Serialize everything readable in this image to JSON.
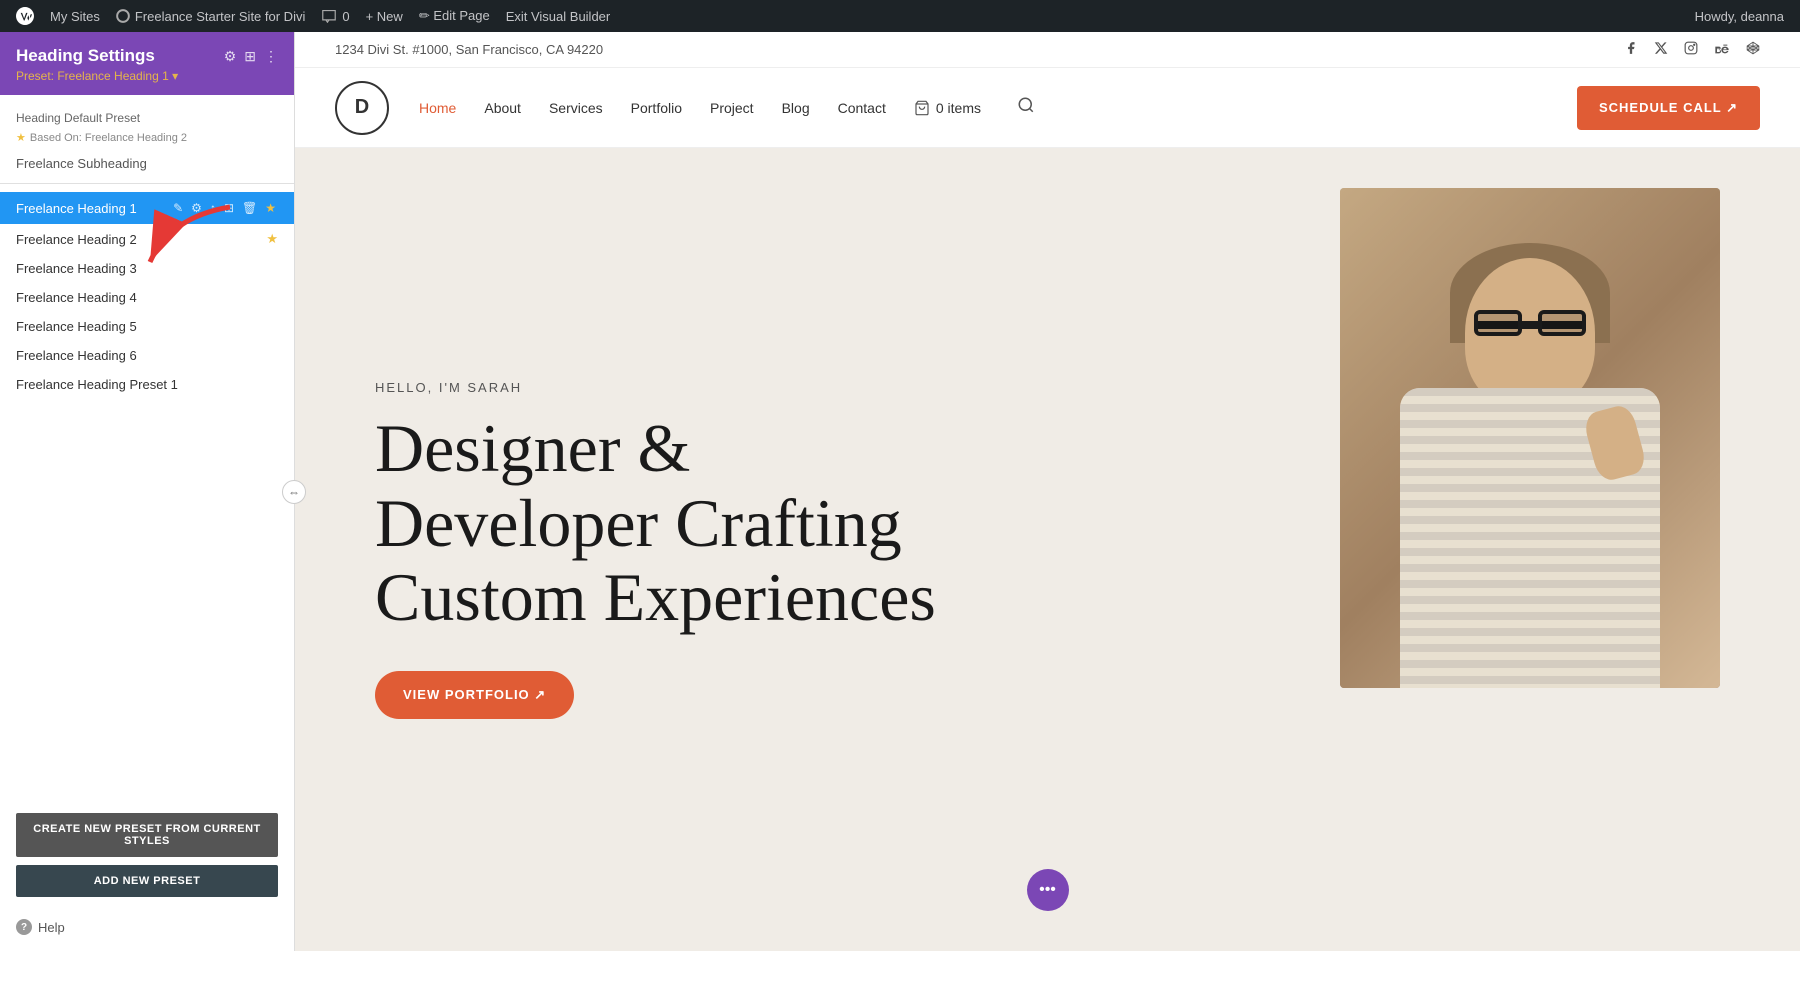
{
  "adminBar": {
    "wpIcon": "⚙",
    "mySites": "My Sites",
    "siteName": "Freelance Starter Site for Divi",
    "comments": "💬",
    "commentCount": "0",
    "new": "+ New",
    "editPage": "✏ Edit Page",
    "exitBuilder": "Exit Visual Builder",
    "howdy": "Howdy, deanna",
    "screenReader": "🖥"
  },
  "panel": {
    "title": "Heading Settings",
    "presetLabel": "Preset: Freelance Heading 1 ▾",
    "headerIcons": [
      "⚙",
      "⊞",
      "⋮"
    ],
    "defaultPresetLabel": "Heading Default Preset",
    "basedOn": "Based On: Freelance Heading 2",
    "subheadingLabel": "Freelance Subheading",
    "presets": [
      {
        "id": 1,
        "name": "Freelance Heading 1",
        "active": true,
        "icons": [
          "✎",
          "⚙",
          "↑",
          "⊞",
          "🗑",
          "★"
        ]
      },
      {
        "id": 2,
        "name": "Freelance Heading 2",
        "active": false,
        "star": true
      },
      {
        "id": 3,
        "name": "Freelance Heading 3",
        "active": false
      },
      {
        "id": 4,
        "name": "Freelance Heading 4",
        "active": false
      },
      {
        "id": 5,
        "name": "Freelance Heading 5",
        "active": false
      },
      {
        "id": 6,
        "name": "Freelance Heading 6",
        "active": false
      },
      {
        "id": 7,
        "name": "Freelance Heading Preset 1",
        "active": false
      }
    ],
    "createPresetBtn": "CREATE NEW PRESET FROM CURRENT STYLES",
    "addPresetBtn": "ADD NEW PRESET",
    "helpLabel": "Help"
  },
  "site": {
    "address": "1234 Divi St. #1000, San Francisco, CA 94220",
    "logoLetter": "D",
    "nav": {
      "home": "Home",
      "about": "About",
      "services": "Services",
      "portfolio": "Portfolio",
      "project": "Project",
      "blog": "Blog",
      "contact": "Contact",
      "cart": "0 items"
    },
    "scheduleBtn": "SCHEDULE CALL ↗",
    "hero": {
      "subtitle": "HELLO, I'M SARAH",
      "title": "Designer & Developer Crafting Custom Experiences",
      "ctaBtn": "VIEW PORTFOLIO ↗"
    }
  },
  "bottomToolbar": {
    "cancel": "✕",
    "undo": "↺",
    "redo": "↻",
    "save": "✓"
  }
}
